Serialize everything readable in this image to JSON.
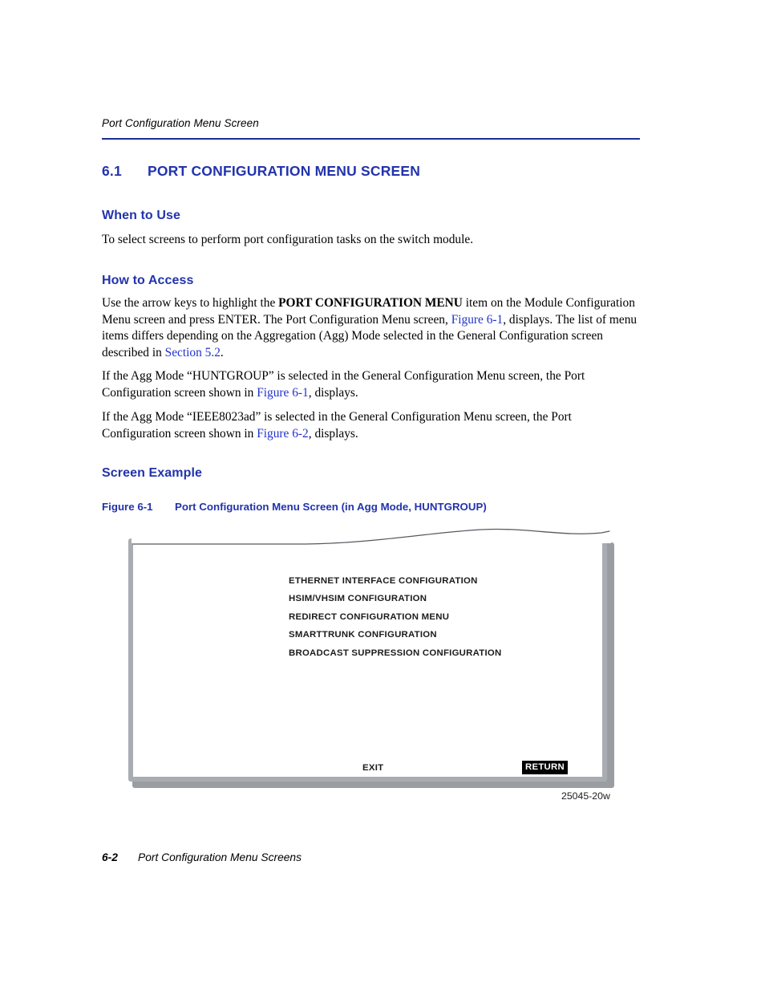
{
  "page": {
    "running_header": "Port Configuration Menu Screen",
    "footer_page_number": "6-2",
    "footer_title": "Port Configuration Menu Screens",
    "accent_blue": "#2233ad",
    "link_blue": "#2233cc",
    "rule_color": "#1b2f91"
  },
  "section": {
    "number": "6.1",
    "title": "PORT CONFIGURATION MENU SCREEN"
  },
  "when_to_use": {
    "heading": "When to Use",
    "body": "To select screens to perform port configuration tasks on the switch module."
  },
  "how_to_access": {
    "heading": "How to Access",
    "paragraph1": {
      "part1": "Use the arrow keys to highlight the ",
      "bold1": "PORT CONFIGURATION MENU",
      "part2": " item on the Module Configuration Menu screen and press ENTER. The Port Configuration Menu screen, ",
      "link1": "Figure 6-1",
      "part3": ", displays. The list of menu items differs depending on the Aggregation (Agg) Mode selected in the General Configuration screen described in ",
      "link2": "Section 5.2",
      "part4": "."
    },
    "paragraph2": {
      "part1": "If the Agg Mode “HUNTGROUP” is selected in the General Configuration Menu screen, the Port Configuration screen shown in ",
      "link1": "Figure 6-1",
      "part2": ", displays."
    },
    "paragraph3": {
      "part1": "If the Agg Mode “IEEE8023ad” is selected in the General Configuration Menu screen, the Port Configuration screen shown in ",
      "link1": "Figure 6-2",
      "part2": ", displays."
    }
  },
  "screen_example": {
    "heading": "Screen Example",
    "figure_caption_number": "Figure 6-1",
    "figure_caption_text": "Port Configuration Menu Screen (in Agg Mode, HUNTGROUP)",
    "figure_id": "25045-20w"
  },
  "terminal_screen": {
    "menu_items": [
      "ETHERNET INTERFACE CONFIGURATION",
      "HSIM/VHSIM CONFIGURATION",
      "REDIRECT CONFIGURATION MENU",
      "SMARTTRUNK CONFIGURATION",
      "BROADCAST SUPPRESSION CONFIGURATION"
    ],
    "exit_label": "EXIT",
    "return_label": "RETURN",
    "return_highlighted": true
  }
}
